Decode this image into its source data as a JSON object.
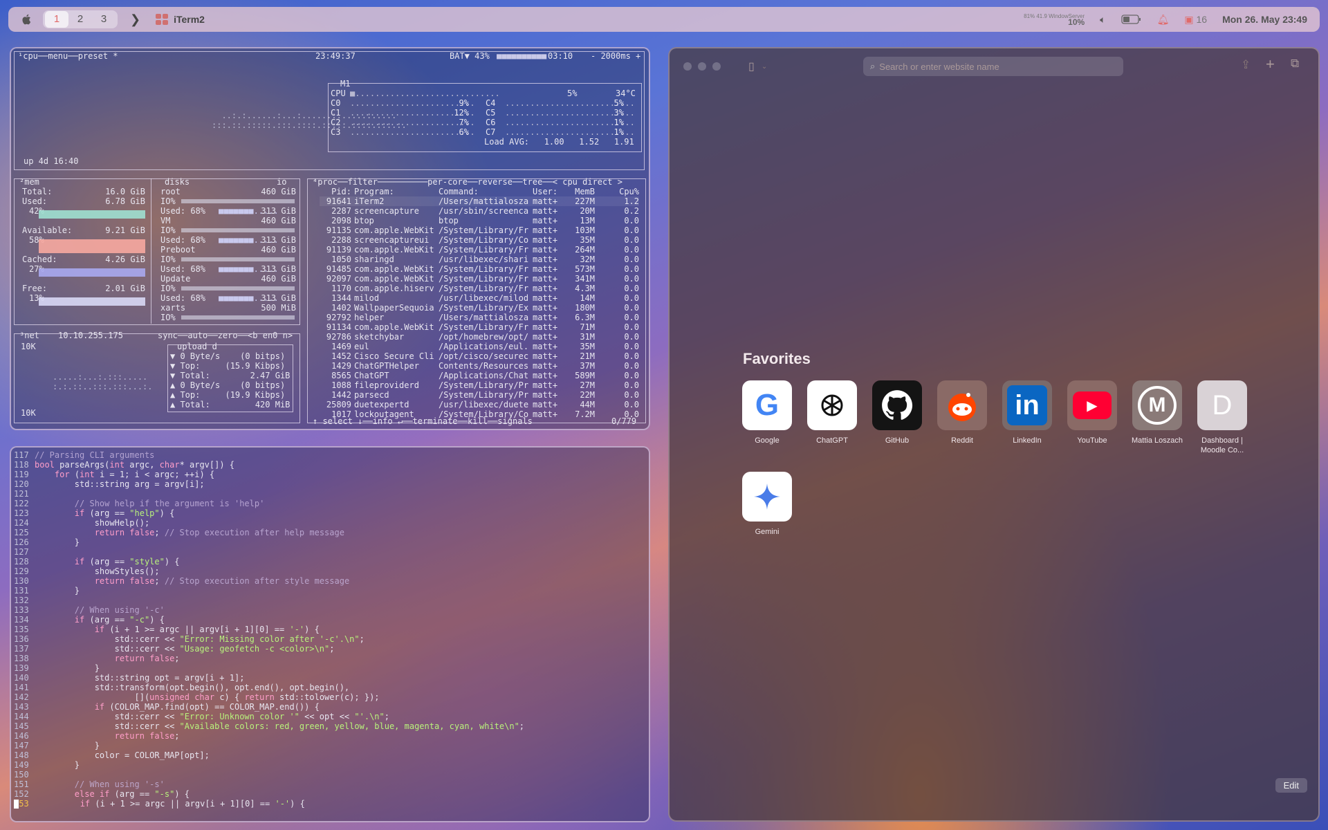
{
  "menubar": {
    "spaces": [
      "1",
      "2",
      "3"
    ],
    "active_space": "1",
    "app_name": "iTerm2",
    "windowserver_label": "81% 41.9 WindowServer",
    "windowserver_pct": "10%",
    "notification_count": "16",
    "datetime": "Mon 26. May 23:49"
  },
  "btop": {
    "cpu_header": "¹cpu──menu──preset *",
    "clock": "23:49:37",
    "battery": "BAT▼ 43%",
    "battery_time": "03:10",
    "refresh": "- 2000ms +",
    "uptime": "up 4d 16:40",
    "cpu_model": "M1",
    "cpu_total": "CPU",
    "cpu_total_pct": "5%",
    "cpu_temp": "34°C",
    "cores": [
      {
        "name": "C0",
        "pct": "9%"
      },
      {
        "name": "C1",
        "pct": "12%"
      },
      {
        "name": "C2",
        "pct": "7%"
      },
      {
        "name": "C3",
        "pct": "6%"
      },
      {
        "name": "C4",
        "pct": "5%"
      },
      {
        "name": "C5",
        "pct": "3%"
      },
      {
        "name": "C6",
        "pct": "1%"
      },
      {
        "name": "C7",
        "pct": "1%"
      }
    ],
    "load_avg": "Load AVG:   1.00   1.52   1.91",
    "mem_title": "²mem",
    "mem": [
      {
        "label": "Total:",
        "value": "16.0 GiB",
        "pct": ""
      },
      {
        "label": "Used:",
        "value": "6.78 GiB",
        "pct": "42%"
      },
      {
        "label": "Available:",
        "value": "9.21 GiB",
        "pct": "58%"
      },
      {
        "label": "Cached:",
        "value": "4.26 GiB",
        "pct": "27%"
      },
      {
        "label": "Free:",
        "value": "2.01 GiB",
        "pct": "13%"
      }
    ],
    "disks_title": "disks",
    "io_label": "io",
    "disks": [
      {
        "name": "root",
        "size": "460 GiB",
        "used": "Used: 68%",
        "used_size": "313 GiB"
      },
      {
        "name": "VM",
        "size": "460 GiB",
        "used": "Used: 68%",
        "used_size": "313 GiB"
      },
      {
        "name": "Preboot",
        "size": "460 GiB",
        "used": "Used: 68%",
        "used_size": "313 GiB"
      },
      {
        "name": "Update",
        "size": "460 GiB",
        "used": "Used: 68%",
        "used_size": "313 GiB"
      },
      {
        "name": "xarts",
        "size": "500 MiB",
        "used": "",
        "used_size": ""
      }
    ],
    "net_title": "³net",
    "net_ip": "10.10.255.175",
    "net_opts": "sync──auto──zero──<b en0 n>",
    "net_scale_top": "10K",
    "net_scale_bottom": "10K",
    "net_stats": [
      "upload d",
      "▼ 0 Byte/s    (0 bitps)",
      "▼ Top:     (15.9 Kibps)",
      "▼ Total:        2.47 GiB",
      "▲ 0 Byte/s    (0 bitps)",
      "▲ Top:     (19.9 Kibps)",
      "▲ Total:         420 MiB"
    ],
    "proc_header": "⁴proc──filter──────────per-core──reverse──tree──< cpu direct >",
    "proc_cols": [
      "Pid:",
      "Program:",
      "Command:",
      "User:",
      "MemB",
      "Cpu%"
    ],
    "processes": [
      [
        "91641",
        "iTerm2",
        "/Users/mattialosza",
        "matt+",
        "227M",
        "1.2"
      ],
      [
        "2287",
        "screencapture",
        "/usr/sbin/screenca",
        "matt+",
        "20M",
        "0.2"
      ],
      [
        "2098",
        "btop",
        "btop",
        "matt+",
        "13M",
        "0.0"
      ],
      [
        "91135",
        "com.apple.WebKit",
        "/System/Library/Fr",
        "matt+",
        "103M",
        "0.0"
      ],
      [
        "2288",
        "screencaptureui",
        "/System/Library/Co",
        "matt+",
        "35M",
        "0.0"
      ],
      [
        "91139",
        "com.apple.WebKit",
        "/System/Library/Fr",
        "matt+",
        "264M",
        "0.0"
      ],
      [
        "1050",
        "sharingd",
        "/usr/libexec/shari",
        "matt+",
        "32M",
        "0.0"
      ],
      [
        "91485",
        "com.apple.WebKit",
        "/System/Library/Fr",
        "matt+",
        "573M",
        "0.0"
      ],
      [
        "92097",
        "com.apple.WebKit",
        "/System/Library/Fr",
        "matt+",
        "341M",
        "0.0"
      ],
      [
        "1170",
        "com.apple.hiserv",
        "/System/Library/Fr",
        "matt+",
        "4.3M",
        "0.0"
      ],
      [
        "1344",
        "milod",
        "/usr/libexec/milod",
        "matt+",
        "14M",
        "0.0"
      ],
      [
        "1402",
        "WallpaperSequoia",
        "/System/Library/Ex",
        "matt+",
        "180M",
        "0.0"
      ],
      [
        "92792",
        "helper",
        "/Users/mattialosza",
        "matt+",
        "6.3M",
        "0.0"
      ],
      [
        "91134",
        "com.apple.WebKit",
        "/System/Library/Fr",
        "matt+",
        "71M",
        "0.0"
      ],
      [
        "92786",
        "sketchybar",
        "/opt/homebrew/opt/",
        "matt+",
        "31M",
        "0.0"
      ],
      [
        "1469",
        "eul",
        "/Applications/eul.",
        "matt+",
        "35M",
        "0.0"
      ],
      [
        "1452",
        "Cisco Secure Cli",
        "/opt/cisco/securec",
        "matt+",
        "21M",
        "0.0"
      ],
      [
        "1429",
        "ChatGPTHelper",
        "Contents/Resources",
        "matt+",
        "37M",
        "0.0"
      ],
      [
        "8565",
        "ChatGPT",
        "/Applications/Chat",
        "matt+",
        "589M",
        "0.0"
      ],
      [
        "1088",
        "fileproviderd",
        "/System/Library/Pr",
        "matt+",
        "27M",
        "0.0"
      ],
      [
        "1442",
        "parsecd",
        "/System/Library/Pr",
        "matt+",
        "22M",
        "0.0"
      ],
      [
        "25809",
        "duetexpertd",
        "/usr/libexec/duete",
        "matt+",
        "44M",
        "0.0"
      ],
      [
        "1017",
        "lockoutagent",
        "/System/Library/Co",
        "matt+",
        "7.2M",
        "0.0"
      ]
    ],
    "proc_footer": "↑ select ↓──info ↵──terminate──kill──signals",
    "proc_count": "0/779"
  },
  "code_lines": [
    {
      "n": "117",
      "html": "<span class=\"cm\">// Parsing CLI arguments</span>"
    },
    {
      "n": "118",
      "html": "<span class=\"kw\">bool</span> parseArgs(<span class=\"kw\">int</span> argc, <span class=\"kw\">char</span>* argv[]) {"
    },
    {
      "n": "119",
      "html": "    <span class=\"kw\">for</span> (<span class=\"kw\">int</span> i = 1; i &lt; argc; ++i) {"
    },
    {
      "n": "120",
      "html": "        std::string arg = argv[i];"
    },
    {
      "n": "121",
      "html": ""
    },
    {
      "n": "122",
      "html": "        <span class=\"cm\">// Show help if the argument is 'help'</span>"
    },
    {
      "n": "123",
      "html": "        <span class=\"kw\">if</span> (arg == <span class=\"str\">\"help\"</span>) {"
    },
    {
      "n": "124",
      "html": "            showHelp();"
    },
    {
      "n": "125",
      "html": "            <span class=\"kw\">return false</span>; <span class=\"cm\">// Stop execution after help message</span>"
    },
    {
      "n": "126",
      "html": "        }"
    },
    {
      "n": "127",
      "html": ""
    },
    {
      "n": "128",
      "html": "        <span class=\"kw\">if</span> (arg == <span class=\"str\">\"style\"</span>) {"
    },
    {
      "n": "129",
      "html": "            showStyles();"
    },
    {
      "n": "130",
      "html": "            <span class=\"kw\">return false</span>; <span class=\"cm\">// Stop execution after style message</span>"
    },
    {
      "n": "131",
      "html": "        }"
    },
    {
      "n": "132",
      "html": ""
    },
    {
      "n": "133",
      "html": "        <span class=\"cm\">// When using '-c'</span>"
    },
    {
      "n": "134",
      "html": "        <span class=\"kw\">if</span> (arg == <span class=\"str\">\"-c\"</span>) {"
    },
    {
      "n": "135",
      "html": "            <span class=\"kw\">if</span> (i + 1 &gt;= argc || argv[i + 1][0] == <span class=\"str\">'-'</span>) {"
    },
    {
      "n": "136",
      "html": "                std::cerr &lt;&lt; <span class=\"str\">\"Error: Missing color after '-c'.\\n\"</span>;"
    },
    {
      "n": "137",
      "html": "                std::cerr &lt;&lt; <span class=\"str\">\"Usage: geofetch -c &lt;color&gt;\\n\"</span>;"
    },
    {
      "n": "138",
      "html": "                <span class=\"kw\">return false</span>;"
    },
    {
      "n": "139",
      "html": "            }"
    },
    {
      "n": "140",
      "html": "            std::string opt = argv[i + 1];"
    },
    {
      "n": "141",
      "html": "            std::transform(opt.begin(), opt.end(), opt.begin(),"
    },
    {
      "n": "142",
      "html": "                    [](<span class=\"kw\">unsigned char</span> c) { <span class=\"kw\">return</span> std::tolower(c); });"
    },
    {
      "n": "143",
      "html": "            <span class=\"kw\">if</span> (COLOR_MAP.find(opt) == COLOR_MAP.end()) {"
    },
    {
      "n": "144",
      "html": "                std::cerr &lt;&lt; <span class=\"str\">\"Error: Unknown color '\"</span> &lt;&lt; opt &lt;&lt; <span class=\"str\">\"'.\\n\"</span>;"
    },
    {
      "n": "145",
      "html": "                std::cerr &lt;&lt; <span class=\"str\">\"Available colors: red, green, yellow, blue, magenta, cyan, white\\n\"</span>;"
    },
    {
      "n": "146",
      "html": "                <span class=\"kw\">return false</span>;"
    },
    {
      "n": "147",
      "html": "            }"
    },
    {
      "n": "148",
      "html": "            color = COLOR_MAP[opt];"
    },
    {
      "n": "149",
      "html": "        }"
    },
    {
      "n": "150",
      "html": ""
    },
    {
      "n": "151",
      "html": "        <span class=\"cm\">// When using '-s'</span>"
    },
    {
      "n": "152",
      "html": "        <span class=\"kw\">else if</span> (arg == <span class=\"str\">\"-s\"</span>) {"
    },
    {
      "n": "153",
      "html": "            <span class=\"kw\">if</span> (i + 1 &gt;= argc || argv[i + 1][0] == <span class=\"str\">'-'</span>) {"
    }
  ],
  "safari": {
    "url_placeholder": "Search or enter website name",
    "favorites_title": "Favorites",
    "favorites": [
      {
        "name": "Google",
        "icon": "google-icon"
      },
      {
        "name": "ChatGPT",
        "icon": "chatgpt-icon"
      },
      {
        "name": "GitHub",
        "icon": "github-icon"
      },
      {
        "name": "Reddit",
        "icon": "reddit-icon"
      },
      {
        "name": "LinkedIn",
        "icon": "linkedin-icon"
      },
      {
        "name": "YouTube",
        "icon": "youtube-icon"
      },
      {
        "name": "Mattia Loszach",
        "icon": "mattia-icon"
      },
      {
        "name": "Dashboard | Moodle Co...",
        "icon": "moodle-icon"
      },
      {
        "name": "Gemini",
        "icon": "gemini-icon"
      }
    ],
    "edit_label": "Edit"
  },
  "colors": {
    "mem_used": "#9fe0d0",
    "mem_avail": "#f7a9a0",
    "mem_cached": "#a9a9f0",
    "mem_free": "#d8d8f5"
  }
}
